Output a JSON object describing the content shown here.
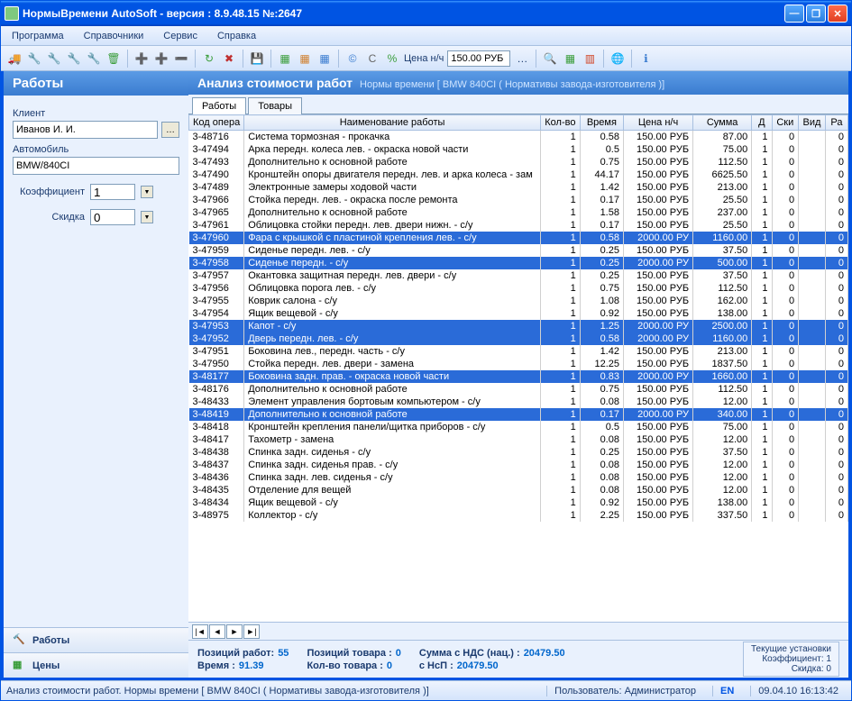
{
  "window": {
    "title": "НормыВремени AutoSoft  - версия : 8.9.48.15    №:2647"
  },
  "menu": [
    "Программа",
    "Справочники",
    "Сервис",
    "Справка"
  ],
  "toolbar": {
    "price_label": "Цена н/ч",
    "price_value": "150.00 РУБ"
  },
  "sidebar": {
    "header": "Работы",
    "client_label": "Клиент",
    "client_value": "Иванов И. И.",
    "car_label": "Автомобиль",
    "car_value": "BMW/840CI",
    "coef_label": "Коэффициент",
    "coef_value": "1",
    "discount_label": "Скидка",
    "discount_value": "0",
    "nav": {
      "works": "Работы",
      "prices": "Цены"
    }
  },
  "main": {
    "header": "Анализ стоимости работ",
    "subtitle": "Нормы времени [ BMW 840CI ( Нормативы завода-изготовителя )]",
    "tabs": [
      "Работы",
      "Товары"
    ],
    "columns": [
      "Код опера",
      "Наименование работы",
      "Кол-во",
      "Время",
      "Цена н/ч",
      "Сумма",
      "Д",
      "Ски",
      "Вид",
      "Ра"
    ]
  },
  "rows": [
    {
      "code": "3-48716",
      "name": "Система тормозная - прокачка",
      "qty": 1,
      "time": "0.58",
      "price": "150.00 РУБ",
      "sum": "87.00",
      "d": 1,
      "sk": 0,
      "v": "",
      "r": 0,
      "sel": false
    },
    {
      "code": "3-47494",
      "name": "Арка передн. колеса лев. - окраска новой части",
      "qty": 1,
      "time": "0.5",
      "price": "150.00 РУБ",
      "sum": "75.00",
      "d": 1,
      "sk": 0,
      "v": "",
      "r": 0,
      "sel": false
    },
    {
      "code": "3-47493",
      "name": "Дополнительно к основной работе",
      "qty": 1,
      "time": "0.75",
      "price": "150.00 РУБ",
      "sum": "112.50",
      "d": 1,
      "sk": 0,
      "v": "",
      "r": 0,
      "sel": false
    },
    {
      "code": "3-47490",
      "name": "Кронштейн опоры двигателя передн. лев. и арка колеса - зам",
      "qty": 1,
      "time": "44.17",
      "price": "150.00 РУБ",
      "sum": "6625.50",
      "d": 1,
      "sk": 0,
      "v": "",
      "r": 0,
      "sel": false
    },
    {
      "code": "3-47489",
      "name": "Электронные замеры ходовой части",
      "qty": 1,
      "time": "1.42",
      "price": "150.00 РУБ",
      "sum": "213.00",
      "d": 1,
      "sk": 0,
      "v": "",
      "r": 0,
      "sel": false
    },
    {
      "code": "3-47966",
      "name": "Стойка передн. лев. - окраска после ремонта",
      "qty": 1,
      "time": "0.17",
      "price": "150.00 РУБ",
      "sum": "25.50",
      "d": 1,
      "sk": 0,
      "v": "",
      "r": 0,
      "sel": false
    },
    {
      "code": "3-47965",
      "name": "Дополнительно к основной работе",
      "qty": 1,
      "time": "1.58",
      "price": "150.00 РУБ",
      "sum": "237.00",
      "d": 1,
      "sk": 0,
      "v": "",
      "r": 0,
      "sel": false
    },
    {
      "code": "3-47961",
      "name": "Облицовка стойки передн. лев. двери нижн. - с/у",
      "qty": 1,
      "time": "0.17",
      "price": "150.00 РУБ",
      "sum": "25.50",
      "d": 1,
      "sk": 0,
      "v": "",
      "r": 0,
      "sel": false
    },
    {
      "code": "3-47960",
      "name": "Фара с крышкой с пластиной крепления лев. - с/у",
      "qty": 1,
      "time": "0.58",
      "price": "2000.00 РУ",
      "sum": "1160.00",
      "d": 1,
      "sk": 0,
      "v": "",
      "r": 0,
      "sel": true
    },
    {
      "code": "3-47959",
      "name": "Сиденье передн. лев. - с/у",
      "qty": 1,
      "time": "0.25",
      "price": "150.00 РУБ",
      "sum": "37.50",
      "d": 1,
      "sk": 0,
      "v": "",
      "r": 0,
      "sel": false
    },
    {
      "code": "3-47958",
      "name": "Сиденье передн. - с/у",
      "qty": 1,
      "time": "0.25",
      "price": "2000.00 РУ",
      "sum": "500.00",
      "d": 1,
      "sk": 0,
      "v": "",
      "r": 0,
      "sel": true
    },
    {
      "code": "3-47957",
      "name": "Окантовка защитная передн. лев. двери - с/у",
      "qty": 1,
      "time": "0.25",
      "price": "150.00 РУБ",
      "sum": "37.50",
      "d": 1,
      "sk": 0,
      "v": "",
      "r": 0,
      "sel": false
    },
    {
      "code": "3-47956",
      "name": "Облицовка порога лев. - с/у",
      "qty": 1,
      "time": "0.75",
      "price": "150.00 РУБ",
      "sum": "112.50",
      "d": 1,
      "sk": 0,
      "v": "",
      "r": 0,
      "sel": false
    },
    {
      "code": "3-47955",
      "name": "Коврик салона - с/у",
      "qty": 1,
      "time": "1.08",
      "price": "150.00 РУБ",
      "sum": "162.00",
      "d": 1,
      "sk": 0,
      "v": "",
      "r": 0,
      "sel": false
    },
    {
      "code": "3-47954",
      "name": "Ящик вещевой - с/у",
      "qty": 1,
      "time": "0.92",
      "price": "150.00 РУБ",
      "sum": "138.00",
      "d": 1,
      "sk": 0,
      "v": "",
      "r": 0,
      "sel": false
    },
    {
      "code": "3-47953",
      "name": "Капот - с/у",
      "qty": 1,
      "time": "1.25",
      "price": "2000.00 РУ",
      "sum": "2500.00",
      "d": 1,
      "sk": 0,
      "v": "",
      "r": 0,
      "sel": true
    },
    {
      "code": "3-47952",
      "name": "Дверь передн. лев. - с/у",
      "qty": 1,
      "time": "0.58",
      "price": "2000.00 РУ",
      "sum": "1160.00",
      "d": 1,
      "sk": 0,
      "v": "",
      "r": 0,
      "sel": true
    },
    {
      "code": "3-47951",
      "name": "Боковина лев., передн. часть - с/у",
      "qty": 1,
      "time": "1.42",
      "price": "150.00 РУБ",
      "sum": "213.00",
      "d": 1,
      "sk": 0,
      "v": "",
      "r": 0,
      "sel": false
    },
    {
      "code": "3-47950",
      "name": "Стойка передн. лев. двери - замена",
      "qty": 1,
      "time": "12.25",
      "price": "150.00 РУБ",
      "sum": "1837.50",
      "d": 1,
      "sk": 0,
      "v": "",
      "r": 0,
      "sel": false
    },
    {
      "code": "3-48177",
      "name": "Боковина задн. прав. - окраска новой части",
      "qty": 1,
      "time": "0.83",
      "price": "2000.00 РУ",
      "sum": "1660.00",
      "d": 1,
      "sk": 0,
      "v": "",
      "r": 0,
      "sel": true
    },
    {
      "code": "3-48176",
      "name": "Дополнительно к основной работе",
      "qty": 1,
      "time": "0.75",
      "price": "150.00 РУБ",
      "sum": "112.50",
      "d": 1,
      "sk": 0,
      "v": "",
      "r": 0,
      "sel": false
    },
    {
      "code": "3-48433",
      "name": "Элемент управления бортовым компьютером - с/у",
      "qty": 1,
      "time": "0.08",
      "price": "150.00 РУБ",
      "sum": "12.00",
      "d": 1,
      "sk": 0,
      "v": "",
      "r": 0,
      "sel": false
    },
    {
      "code": "3-48419",
      "name": "Дополнительно к основной работе",
      "qty": 1,
      "time": "0.17",
      "price": "2000.00 РУ",
      "sum": "340.00",
      "d": 1,
      "sk": 0,
      "v": "",
      "r": 0,
      "sel": true
    },
    {
      "code": "3-48418",
      "name": "Кронштейн крепления панели/щитка приборов - с/у",
      "qty": 1,
      "time": "0.5",
      "price": "150.00 РУБ",
      "sum": "75.00",
      "d": 1,
      "sk": 0,
      "v": "",
      "r": 0,
      "sel": false
    },
    {
      "code": "3-48417",
      "name": "Тахометр - замена",
      "qty": 1,
      "time": "0.08",
      "price": "150.00 РУБ",
      "sum": "12.00",
      "d": 1,
      "sk": 0,
      "v": "",
      "r": 0,
      "sel": false
    },
    {
      "code": "3-48438",
      "name": "Спинка задн. сиденья - с/у",
      "qty": 1,
      "time": "0.25",
      "price": "150.00 РУБ",
      "sum": "37.50",
      "d": 1,
      "sk": 0,
      "v": "",
      "r": 0,
      "sel": false
    },
    {
      "code": "3-48437",
      "name": "Спинка задн. сиденья прав. - с/у",
      "qty": 1,
      "time": "0.08",
      "price": "150.00 РУБ",
      "sum": "12.00",
      "d": 1,
      "sk": 0,
      "v": "",
      "r": 0,
      "sel": false
    },
    {
      "code": "3-48436",
      "name": "Спинка задн. лев. сиденья - с/у",
      "qty": 1,
      "time": "0.08",
      "price": "150.00 РУБ",
      "sum": "12.00",
      "d": 1,
      "sk": 0,
      "v": "",
      "r": 0,
      "sel": false
    },
    {
      "code": "3-48435",
      "name": "Отделение для вещей",
      "qty": 1,
      "time": "0.08",
      "price": "150.00 РУБ",
      "sum": "12.00",
      "d": 1,
      "sk": 0,
      "v": "",
      "r": 0,
      "sel": false
    },
    {
      "code": "3-48434",
      "name": "Ящик вещевой - с/у",
      "qty": 1,
      "time": "0.92",
      "price": "150.00 РУБ",
      "sum": "138.00",
      "d": 1,
      "sk": 0,
      "v": "",
      "r": 0,
      "sel": false
    },
    {
      "code": "3-48975",
      "name": "Коллектор - с/у",
      "qty": 1,
      "time": "2.25",
      "price": "150.00 РУБ",
      "sum": "337.50",
      "d": 1,
      "sk": 0,
      "v": "",
      "r": 0,
      "sel": false
    }
  ],
  "summary": {
    "pos_works_label": "Позиций работ:",
    "pos_works": "55",
    "time_label": "Время :",
    "time": "91.39",
    "pos_goods_label": "Позиций товара :",
    "pos_goods": "0",
    "qty_goods_label": "Кол-во товара :",
    "qty_goods": "0",
    "sum_nds_label": "Сумма с НДС (нац.) :",
    "sum_nds": "20479.50",
    "sum_nsp_label": "с НсП :",
    "sum_nsp": "20479.50",
    "settings_title": "Текущие установки",
    "settings_coef": "Коэффициент: 1",
    "settings_disc": "Скидка: 0"
  },
  "status": {
    "left": "Анализ стоимости работ. Нормы времени [ BMW 840CI ( Нормативы завода-изготовителя )]",
    "user": "Пользователь: Администратор",
    "lang": "EN",
    "datetime": "09.04.10  16:13:42"
  }
}
